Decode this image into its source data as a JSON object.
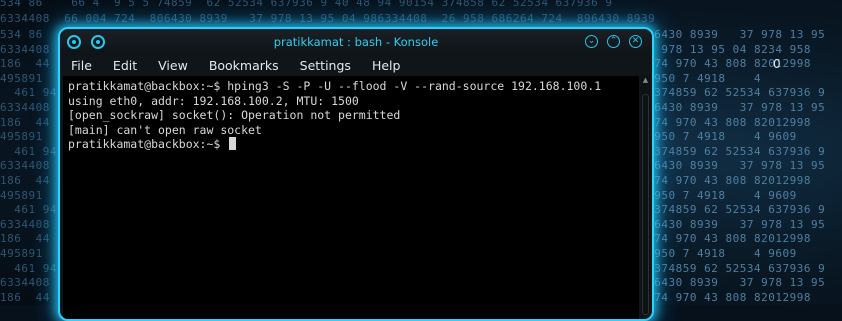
{
  "window": {
    "title": "pratikkamat : bash - Konsole",
    "accent_color": "#2ad2ff",
    "minimize_icon": "chevron-down-circle",
    "maximize_icon": "chevron-up-circle",
    "close_icon": "close-circle"
  },
  "menu": {
    "items": [
      "File",
      "Edit",
      "View",
      "Bookmarks",
      "Settings",
      "Help"
    ]
  },
  "terminal": {
    "lines": [
      "pratikkamat@backbox:~$ hping3 -S -P -U --flood -V --rand-source 192.168.100.1",
      "using eth0, addr: 192.168.100.2, MTU: 1500",
      "[open_sockraw] socket(): Operation not permitted",
      "[main] can't open raw socket",
      "pratikkamat@backbox:~$ "
    ]
  },
  "desktop": {
    "right_label": "0",
    "wallpaper_right_lines": [
      "896430 8939   37 978 13 95",
      "5  978 13 95 04 8234 958",
      "2574 970 43 808 82012998",
      "0 950 7 4918    4",
      "5 374859 62 52534 637936 9",
      "896430 8939   37 978 13 95",
      "2574 970 43 808 82012998",
      "0 950 7 4918    4 9609",
      "5 374859 62 52534 637936 9",
      "896430 8939   37 978 13 95",
      "2574 970 43 808 82012998",
      "0 950 7 4918    4 9609",
      "5 374859 62 52534 637936 9",
      "896430 8939   37 978 13 95",
      "2574 970 43 808 82012998",
      "0 950 7 4918    4 9609",
      "5 374859 62 52534 637936 9",
      "896430 8939   37 978 13 95",
      "2574 970 43 808 82012998",
      "0 950 7 4918    4 9609"
    ],
    "wallpaper_left_lines": [
      "534 86",
      "6334408",
      "186  44 2",
      "495891",
      "  461 94",
      "6334408",
      "186  44 2",
      "495891",
      "  461 94",
      "6334408",
      "186  44 2",
      "495891",
      "  461 94",
      "6334408",
      "186  44 2",
      "495891",
      "  461 94",
      "6334408",
      "186  44 2",
      "495891"
    ],
    "wallpaper_top_line": "534 86    66 4  9 5 5 74859  62 52534 637936 9 40 48 94 90154 374858 62 52534 637936 9",
    "wallpaper_top_line2": "6334408  66 004 724  806430 8939   37 978 13 95 04 986334408  26 958 686264 724  896430 8939"
  }
}
